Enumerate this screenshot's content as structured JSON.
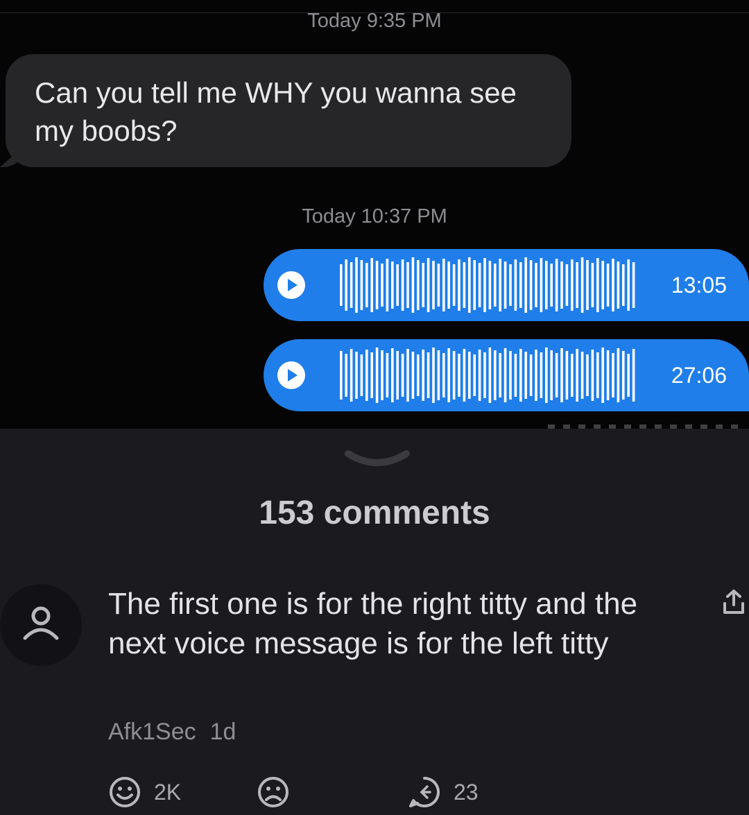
{
  "chat": {
    "timestamp_1": "Today 9:35 PM",
    "incoming_message": "Can you tell me WHY you wanna see my boobs?",
    "timestamp_2": "Today 10:37 PM",
    "voice_messages": [
      {
        "duration": "13:05"
      },
      {
        "duration": "27:06"
      }
    ],
    "colors": {
      "outgoing": "#1f7ee9",
      "incoming": "#262629"
    }
  },
  "comments_header": {
    "count_label": "153 comments"
  },
  "comment": {
    "text": "The first one is for the right titty and the next voice message is for the left titty",
    "author": "Afk1Sec",
    "age": "1d",
    "reactions": {
      "happy_count": "2K",
      "replies_count": "23"
    },
    "icons": [
      "avatar-icon",
      "share-icon",
      "smile-icon",
      "frown-icon",
      "reply-icon"
    ]
  }
}
